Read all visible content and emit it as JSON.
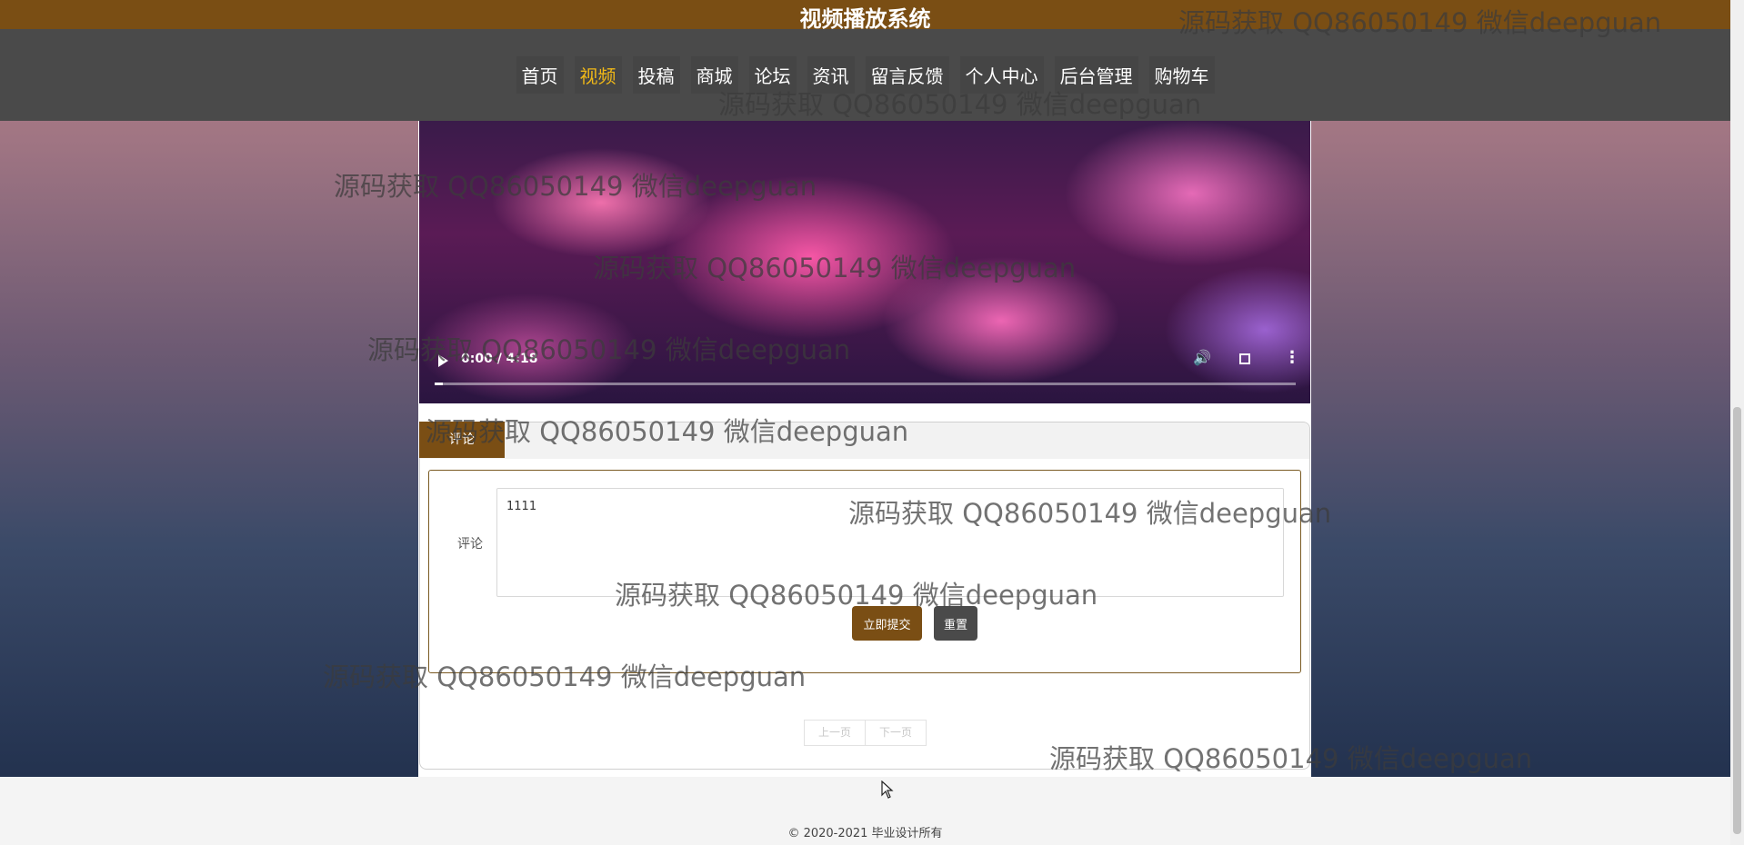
{
  "header": {
    "site_title": "视频播放系统"
  },
  "nav": {
    "items": [
      {
        "label": "首页",
        "active": false
      },
      {
        "label": "视频",
        "active": true
      },
      {
        "label": "投稿",
        "active": false
      },
      {
        "label": "商城",
        "active": false
      },
      {
        "label": "论坛",
        "active": false
      },
      {
        "label": "资讯",
        "active": false
      },
      {
        "label": "留言反馈",
        "active": false
      },
      {
        "label": "个人中心",
        "active": false
      },
      {
        "label": "后台管理",
        "active": false
      },
      {
        "label": "购物车",
        "active": false
      }
    ]
  },
  "video": {
    "time": "0:00 / 4:18",
    "progress": 0.01,
    "controls": [
      "play-icon",
      "volume-icon",
      "fullscreen-icon",
      "menu-icon"
    ]
  },
  "comment": {
    "tab_label": "评论",
    "field_label": "评论",
    "textarea_value": "1111",
    "submit_label": "立即提交",
    "reset_label": "重置"
  },
  "pager": {
    "prev_label": "上一页",
    "next_label": "下一页"
  },
  "footer": {
    "copyright": "© 2020-2021 毕业设计所有"
  },
  "watermark": {
    "text": "源码获取 QQ86050149 微信deepguan"
  },
  "colors": {
    "brand_brown": "#7a4e14",
    "nav_bg": "#4a4a4a",
    "nav_active": "#f0b818"
  }
}
